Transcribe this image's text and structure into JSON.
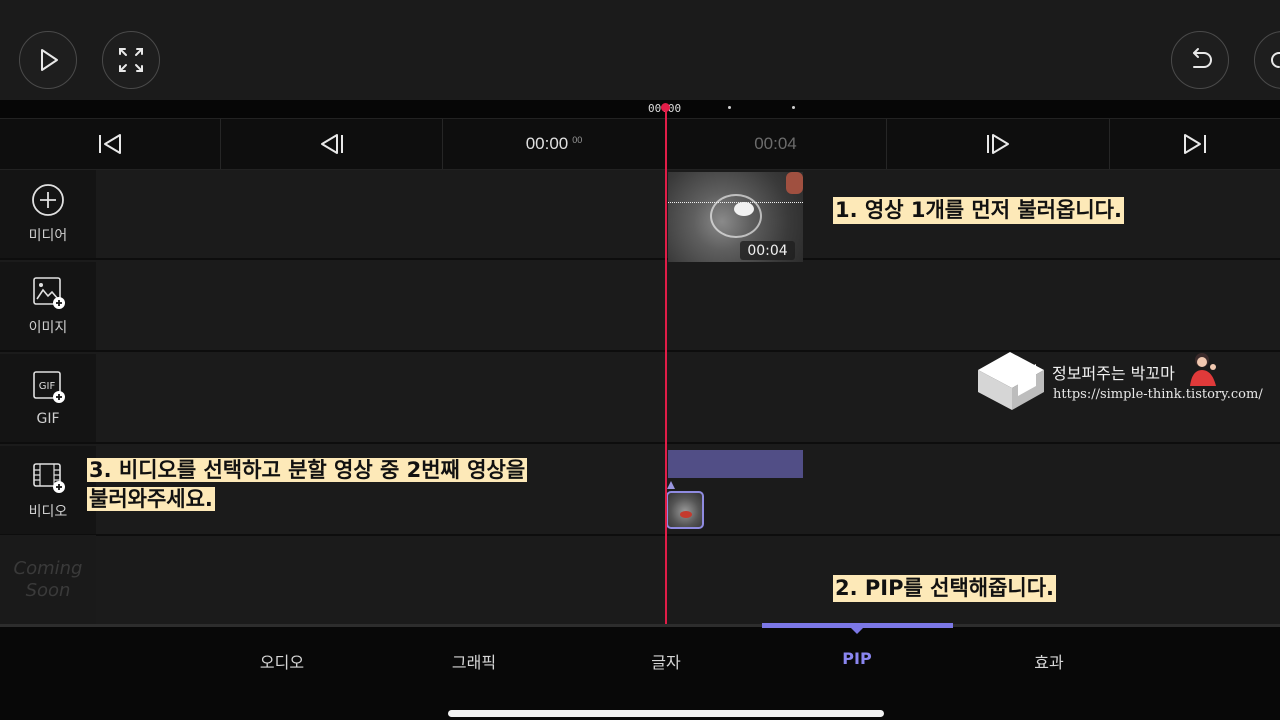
{
  "ruler": {
    "time": "00:00"
  },
  "controls": {
    "current_time": "00:00",
    "current_frames": "00",
    "next_time": "00:04"
  },
  "tracks": {
    "media": {
      "label": "미디어"
    },
    "image": {
      "label": "이미지"
    },
    "gif": {
      "label": "GIF",
      "icon_text": "GIF"
    },
    "video": {
      "label": "비디오"
    },
    "coming_soon": {
      "line1": "Coming",
      "line2": "Soon"
    }
  },
  "clip": {
    "duration": "00:04"
  },
  "annotations": {
    "step1": "1. 영상 1개를 먼저 불러옵니다.",
    "step2": "2. PIP를 선택해줍니다.",
    "step3_line1": "3. 비디오를 선택하고 분할 영상 중 2번째 영상을",
    "step3_line2": "불러와주세요."
  },
  "watermark": {
    "title": "정보퍼주는 박꼬마",
    "url": "https://simple-think.tistory.com/"
  },
  "tabs": [
    {
      "label": "오디오",
      "active": false
    },
    {
      "label": "그래픽",
      "active": false
    },
    {
      "label": "글자",
      "active": false
    },
    {
      "label": "PIP",
      "active": true
    },
    {
      "label": "효과",
      "active": false
    }
  ],
  "colors": {
    "accent": "#7c78e6",
    "playhead": "#e11d48",
    "annotation_bg": "#fde9b8",
    "pip_bar": "#514e86"
  }
}
